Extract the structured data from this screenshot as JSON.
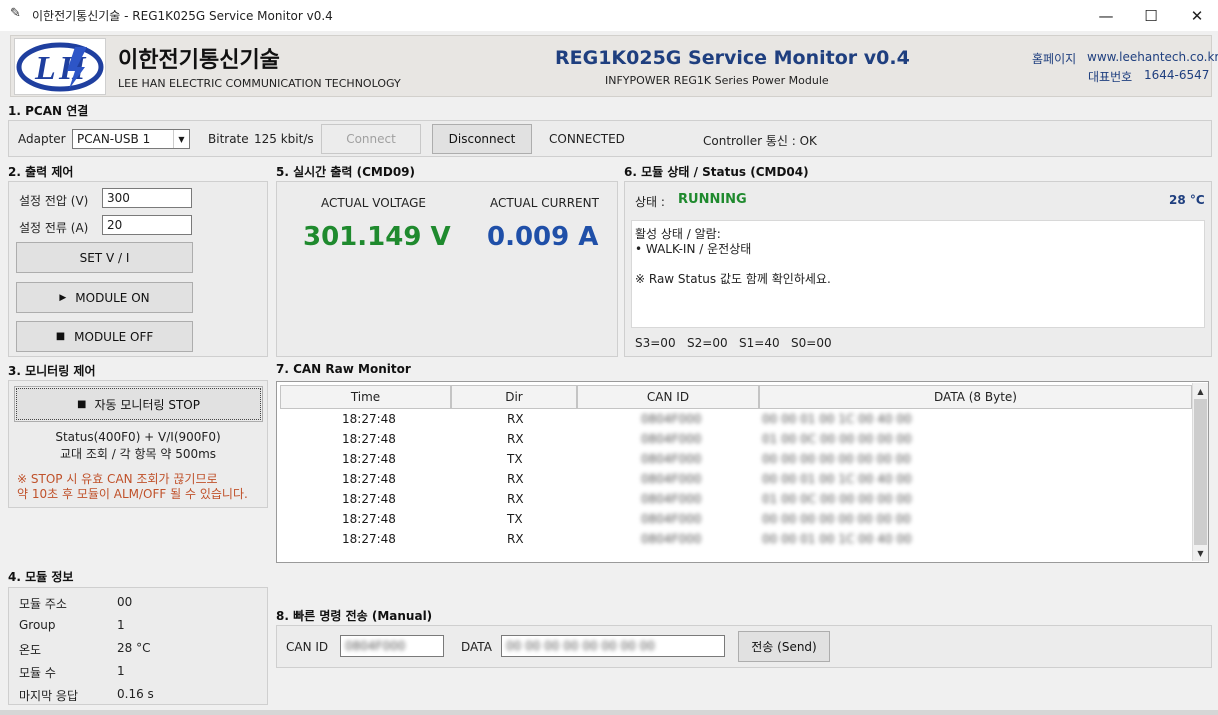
{
  "window": {
    "title": "이한전기통신기술 - REG1K025G Service Monitor v0.4",
    "minimize": "—",
    "maximize": "☐",
    "close": "✕"
  },
  "header": {
    "company_ko": "이한전기통신기술",
    "company_en": "LEE HAN ELECTRIC COMMUNICATION TECHNOLOGY",
    "app_title": "REG1K025G Service Monitor v0.4",
    "app_subtitle": "INFYPOWER REG1K Series Power Module",
    "homepage_label": "홈페이지",
    "homepage_value": "www.leehantech.co.kr",
    "phone_label": "대표번호",
    "phone_value": "1644-6547",
    "brand_color": "#1f3f7f"
  },
  "pcan": {
    "title": "1. PCAN 연결",
    "adapter_label": "Adapter",
    "adapter_value": "PCAN-USB 1",
    "bitrate_label": "Bitrate",
    "bitrate_value": "125 kbit/s",
    "connect_label": "Connect",
    "disconnect_label": "Disconnect",
    "status": "CONNECTED",
    "controller_status": "Controller 통신 : OK"
  },
  "output": {
    "title": "2. 출력 제어",
    "voltage_label": "설정 전압 (V)",
    "voltage_value": "300",
    "current_label": "설정 전류 (A)",
    "current_value": "20",
    "set_label": "SET V / I",
    "module_on_label": "MODULE ON",
    "module_off_label": "MODULE OFF"
  },
  "realtime": {
    "title": "5. 실시간 출력 (CMD09)",
    "voltage_label": "ACTUAL VOLTAGE",
    "voltage_value": "301.149 V",
    "current_label": "ACTUAL CURRENT",
    "current_value": "0.009 A",
    "voltage_color": "#1f8a2e",
    "current_color": "#1f4fa8"
  },
  "status": {
    "title": "6. 모듈 상태 / Status (CMD04)",
    "state_label": "상태 :",
    "state_value": "RUNNING",
    "temperature": "28 °C",
    "active_title": "활성 상태 / 알람:",
    "active_item": "• WALK-IN / 운전상태",
    "note": "※ Raw Status 값도 함께 확인하세요.",
    "raw": "S3=00   S2=00   S1=40   S0=00"
  },
  "monitoring": {
    "title": "3. 모니터링 제어",
    "stop_label": "자동 모니터링 STOP",
    "info_line1": "Status(400F0) + V/I(900F0)",
    "info_line2": "교대 조회 / 각 항목 약 500ms",
    "warning_line1": "※ STOP 시 유효 CAN 조회가 끊기므로",
    "warning_line2": "약 10초 후 모듈이 ALM/OFF 될 수 있습니다.",
    "warning_color": "#c0522b"
  },
  "can_monitor": {
    "title": "7. CAN Raw Monitor",
    "columns": [
      "Time",
      "Dir",
      "CAN ID",
      "DATA (8 Byte)"
    ],
    "rows": [
      {
        "time": "18:27:48",
        "dir": "RX",
        "id": "0804F000",
        "data": "00 00 01 00 1C 00 40 00"
      },
      {
        "time": "18:27:48",
        "dir": "RX",
        "id": "0804F000",
        "data": "01 00 0C 00 00 00 00 00"
      },
      {
        "time": "18:27:48",
        "dir": "TX",
        "id": "0804F000",
        "data": "00 00 00 00 00 00 00 00"
      },
      {
        "time": "18:27:48",
        "dir": "RX",
        "id": "0804F000",
        "data": "00 00 01 00 1C 00 40 00"
      },
      {
        "time": "18:27:48",
        "dir": "RX",
        "id": "0804F000",
        "data": "01 00 0C 00 00 00 00 00"
      },
      {
        "time": "18:27:48",
        "dir": "TX",
        "id": "0804F000",
        "data": "00 00 00 00 00 00 00 00"
      },
      {
        "time": "18:27:48",
        "dir": "RX",
        "id": "0804F000",
        "data": "00 00 01 00 1C 00 40 00"
      }
    ]
  },
  "module_info": {
    "title": "4. 모듈 정보",
    "rows": [
      {
        "label": "모듈 주소",
        "value": "00"
      },
      {
        "label": "Group",
        "value": "1"
      },
      {
        "label": "온도",
        "value": "28 °C"
      },
      {
        "label": "모듈 수",
        "value": "1"
      },
      {
        "label": "마지막 응답",
        "value": "0.16 s"
      }
    ]
  },
  "manual": {
    "title": "8. 빠른 명령 전송 (Manual)",
    "can_id_label": "CAN ID",
    "can_id_value": "0804F000",
    "data_label": "DATA",
    "data_value": "00 00 00 00 00 00 00 00",
    "send_label": "전송 (Send)"
  }
}
